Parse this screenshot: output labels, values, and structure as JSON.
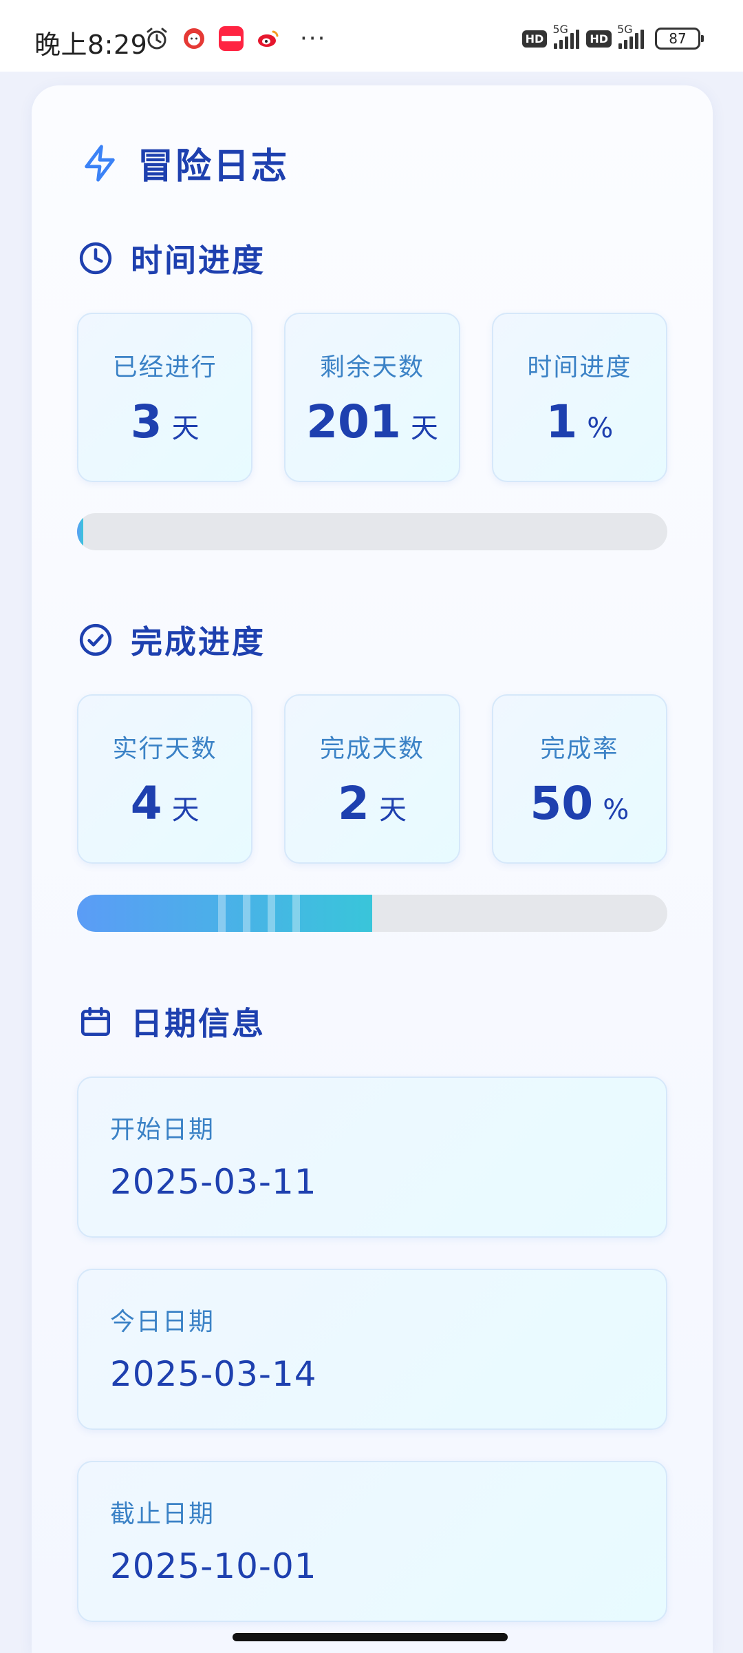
{
  "status_bar": {
    "time": "晚上8:29",
    "app_icons": [
      "alarm-icon",
      "redbook-icon",
      "xiaohongshu-icon",
      "weibo-icon"
    ],
    "more": "···",
    "hd1": "HD",
    "net1": "5G",
    "hd2": "HD",
    "net2": "5G",
    "battery": "87"
  },
  "header": {
    "icon": "lightning-icon",
    "title": "冒险日志"
  },
  "time_progress": {
    "icon": "clock-icon",
    "title": "时间进度",
    "stats": [
      {
        "label": "已经进行",
        "value": "3",
        "unit": "天"
      },
      {
        "label": "剩余天数",
        "value": "201",
        "unit": "天"
      },
      {
        "label": "时间进度",
        "value": "1",
        "unit": "%"
      }
    ],
    "progress_percent": 1
  },
  "completion_progress": {
    "icon": "check-circle-icon",
    "title": "完成进度",
    "stats": [
      {
        "label": "实行天数",
        "value": "4",
        "unit": "天"
      },
      {
        "label": "完成天数",
        "value": "2",
        "unit": "天"
      },
      {
        "label": "完成率",
        "value": "50",
        "unit": "%"
      }
    ],
    "progress_percent": 50
  },
  "date_info": {
    "icon": "calendar-icon",
    "title": "日期信息",
    "items": [
      {
        "label": "开始日期",
        "value": "2025-03-11"
      },
      {
        "label": "今日日期",
        "value": "2025-03-14"
      },
      {
        "label": "截止日期",
        "value": "2025-10-01"
      }
    ]
  },
  "colors": {
    "accent": "#1e40af",
    "label": "#3b82c6",
    "progress_start": "#5b9cf6",
    "progress_end": "#39c5da",
    "track": "#e5e7eb"
  }
}
